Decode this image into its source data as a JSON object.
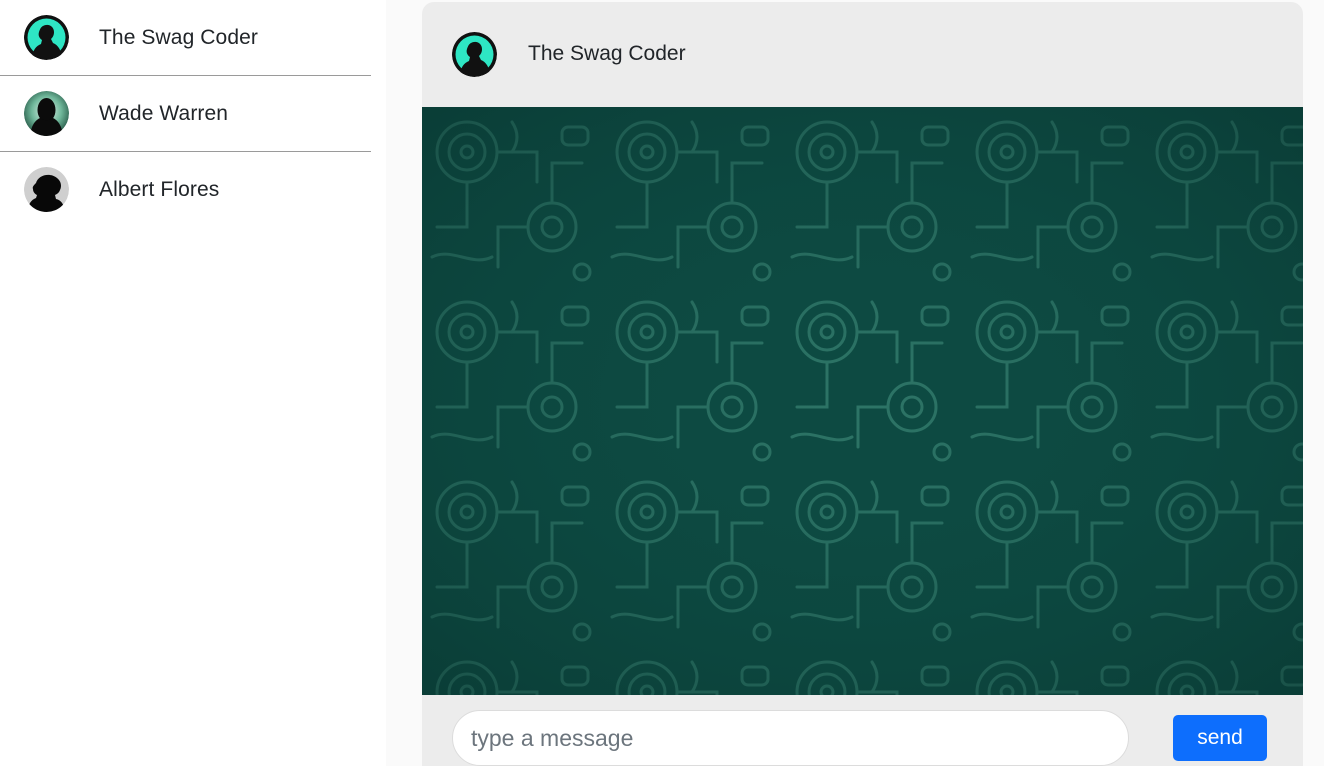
{
  "sidebar": {
    "contacts": [
      {
        "name": "The Swag Coder",
        "avatar_icon": "silhouette-teal-avatar"
      },
      {
        "name": "Wade Warren",
        "avatar_icon": "silhouette-dark-green-avatar"
      },
      {
        "name": "Albert Flores",
        "avatar_icon": "silhouette-gray-avatar"
      }
    ]
  },
  "chat": {
    "header": {
      "name": "The Swag Coder",
      "avatar_icon": "silhouette-teal-avatar"
    },
    "background": {
      "color": "#0d4a42",
      "pattern": "circuit-doodle-pattern"
    },
    "composer": {
      "placeholder": "type a message",
      "value": "",
      "send_label": "send"
    }
  },
  "colors": {
    "accent": "#0d6efd",
    "panel": "#ececec",
    "chat_background": "#0d4a42",
    "avatar_teal": "#2ee6c4"
  }
}
